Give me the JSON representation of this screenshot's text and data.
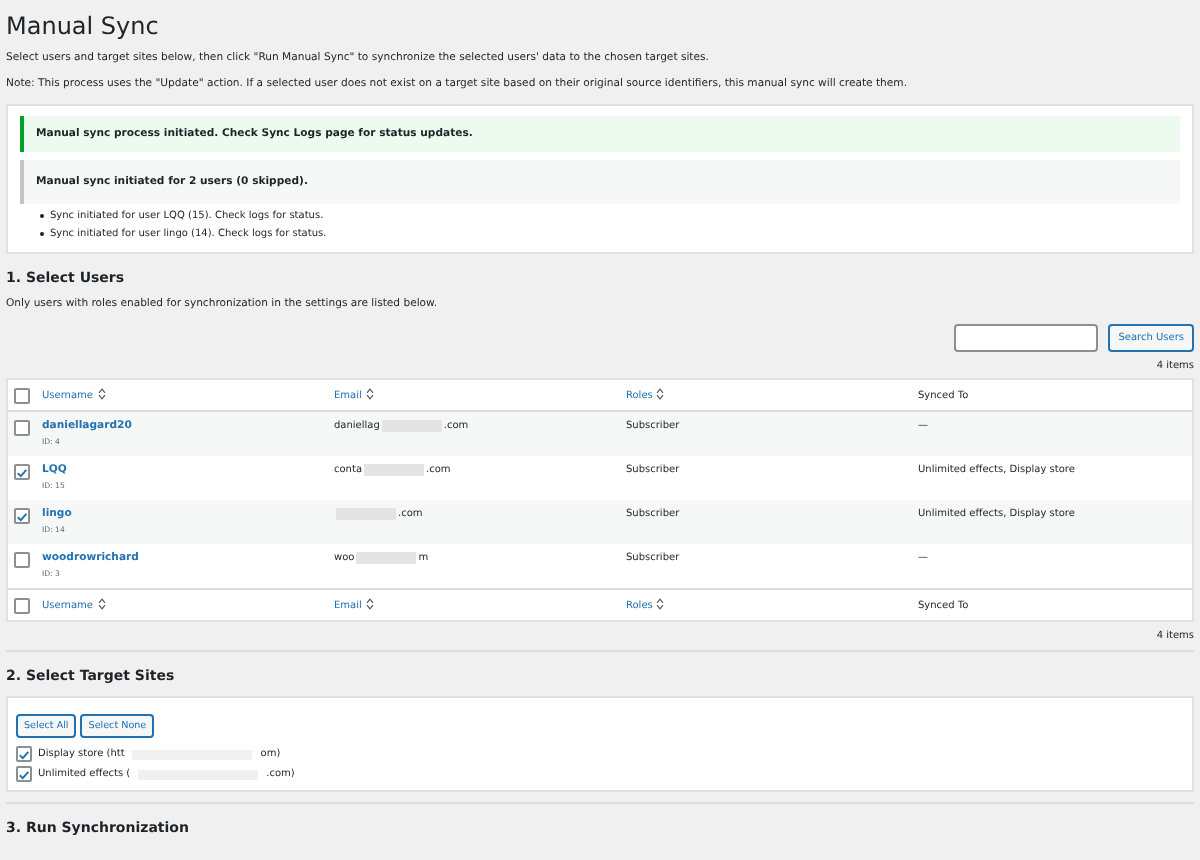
{
  "title": "Manual Sync",
  "intro": "Select users and target sites below, then click \"Run Manual Sync\" to synchronize the selected users' data to the chosen target sites.",
  "note": "Note: This process uses the \"Update\" action. If a selected user does not exist on a target site based on their original source identifiers, this manual sync will create them.",
  "notices": [
    {
      "kind": "success",
      "text": "Manual sync process initiated. Check Sync Logs page for status updates."
    },
    {
      "kind": "info",
      "text": "Manual sync initiated for 2 users (0 skipped)."
    }
  ],
  "notice_items": [
    "Sync initiated for user LQQ (15). Check logs for status.",
    "Sync initiated for user lingo (14). Check logs for status."
  ],
  "users_section": {
    "heading": "1. Select Users",
    "description": "Only users with roles enabled for synchronization in the settings are listed below.",
    "search_button": "Search Users",
    "count_top": "4 items",
    "count_bottom": "4 items"
  },
  "table": {
    "header": {
      "select_all_checked": false,
      "columns": [
        {
          "label": "Username",
          "sortable": true
        },
        {
          "label": "Email",
          "sortable": true
        },
        {
          "label": "Roles",
          "sortable": true
        },
        {
          "label": "Synced To",
          "sortable": false
        }
      ]
    },
    "footer": {
      "select_all_checked": false,
      "columns": [
        {
          "label": "Username",
          "sortable": true
        },
        {
          "label": "Email",
          "sortable": true
        },
        {
          "label": "Roles",
          "sortable": true
        },
        {
          "label": "Synced To",
          "sortable": false
        }
      ]
    },
    "rows": [
      {
        "checked": false,
        "username": "daniellagard20",
        "id": "ID: 4",
        "email_start": "daniellag",
        "email_end": ".com",
        "roles": "Subscriber",
        "synced_to": "—"
      },
      {
        "checked": true,
        "username": "LQQ",
        "id": "ID: 15",
        "email_start": "conta",
        "email_end": ".com",
        "roles": "Subscriber",
        "synced_to": "Unlimited effects, Display store"
      },
      {
        "checked": true,
        "username": "lingo",
        "id": "ID: 14",
        "email_start": "",
        "email_end": ".com",
        "roles": "Subscriber",
        "synced_to": "Unlimited effects, Display store"
      },
      {
        "checked": false,
        "username": "woodrowrichard",
        "id": "ID: 3",
        "email_start": "woo",
        "email_end": "m",
        "roles": "Subscriber",
        "synced_to": "—"
      }
    ]
  },
  "sites_section": {
    "heading": "2. Select Target Sites",
    "buttons": [
      "Select All",
      "Select None"
    ],
    "sites": [
      {
        "checked": true,
        "label_start": "Display store (htt",
        "label_end": "om)"
      },
      {
        "checked": true,
        "label_start": "Unlimited effects (",
        "label_end": ".com)"
      }
    ]
  },
  "next_heading": "3. Run Synchronization"
}
